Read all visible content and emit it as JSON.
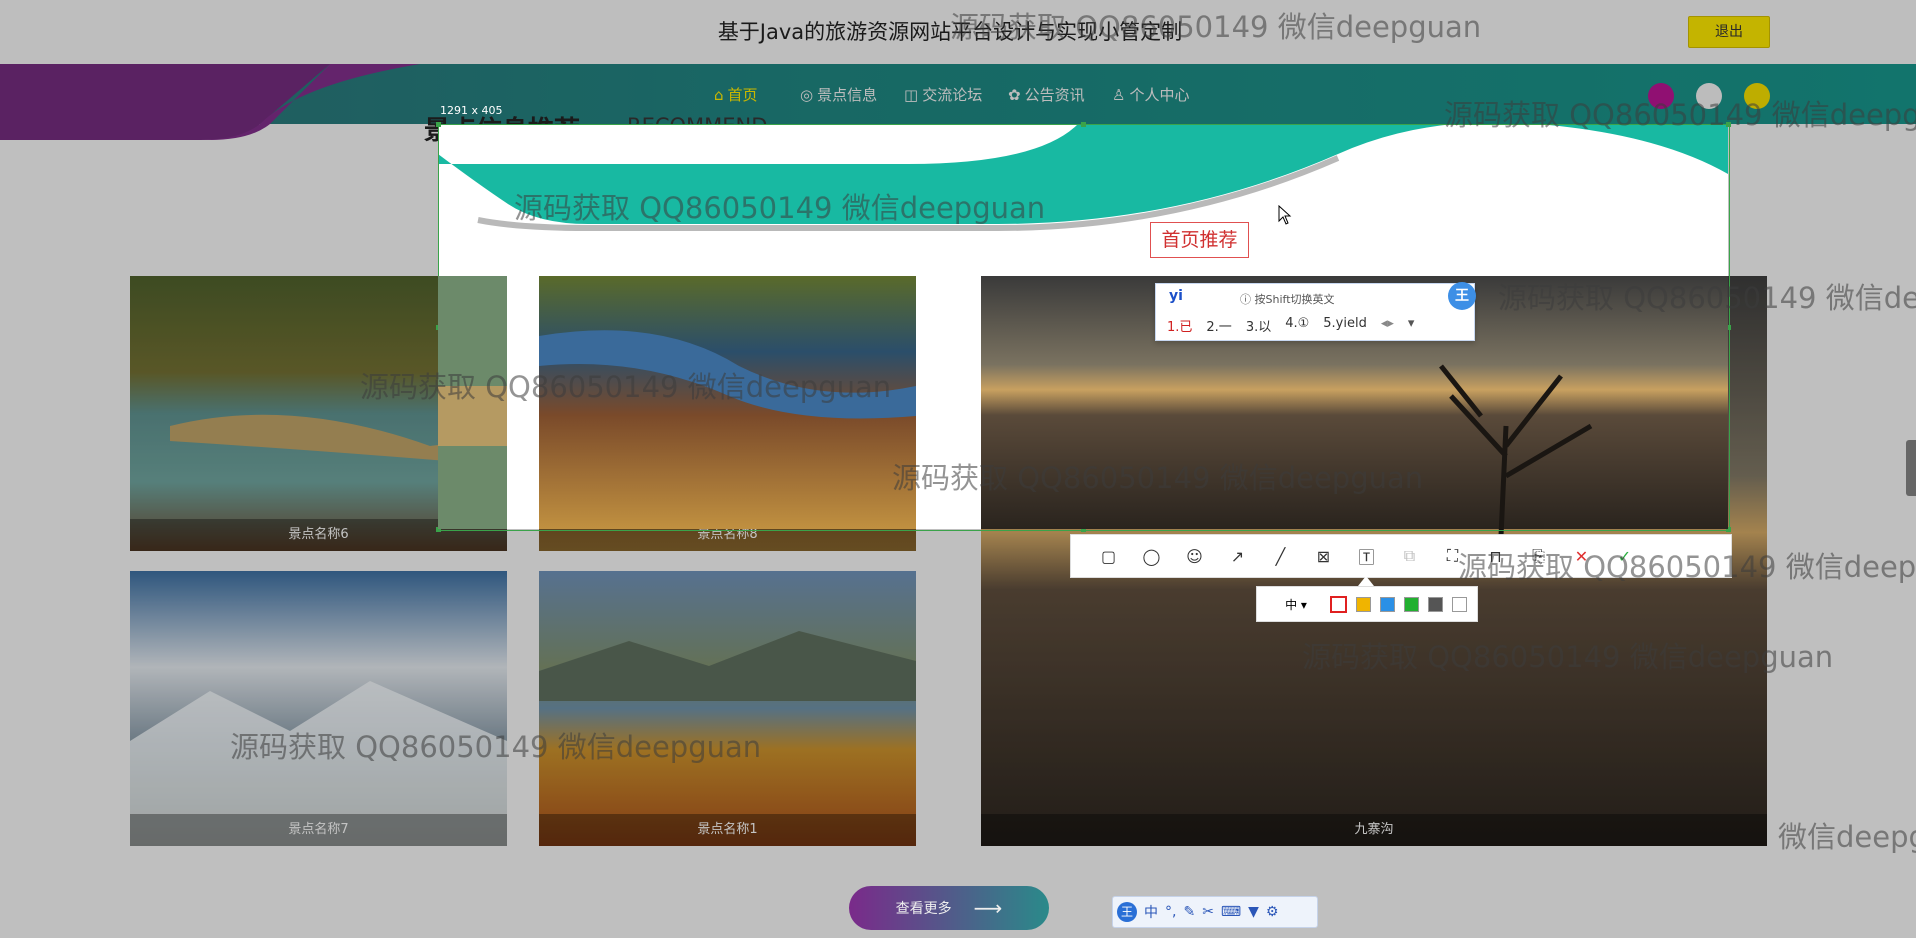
{
  "header": {
    "site_title": "基于Java的旅游资源网站平台设计与实现小管定制",
    "logout_label": "退出"
  },
  "nav": {
    "items": [
      {
        "label": "首页",
        "icon": "home-icon"
      },
      {
        "label": "景点信息",
        "icon": "globe-icon"
      },
      {
        "label": "交流论坛",
        "icon": "gift-icon"
      },
      {
        "label": "公告资讯",
        "icon": "gear-icon"
      },
      {
        "label": "个人中心",
        "icon": "user-icon"
      }
    ],
    "dots": [
      "#b0148c",
      "#e6e6e6",
      "#e8d400"
    ]
  },
  "section": {
    "title": "景点信息推荐",
    "subtitle": "RECOMMEND"
  },
  "spots": [
    {
      "name": "景点名称6"
    },
    {
      "name": "景点名称8"
    },
    {
      "name": "景点名称7"
    },
    {
      "name": "景点名称1"
    },
    {
      "name": "九寨沟"
    }
  ],
  "view_more_label": "查看更多",
  "screenshot_tool": {
    "size_label": "1291 x 405",
    "annotation_text": "首页推荐",
    "size_option": "中",
    "colors": [
      "#e02020",
      "#f0b400",
      "#2b90e6",
      "#22b030",
      "#555555",
      "#ffffff"
    ]
  },
  "ime": {
    "input": "yi",
    "tip": "按Shift切换英文",
    "logo": "王",
    "candidates": [
      "1.已",
      "2.一",
      "3.以",
      "4.①",
      "5.yield"
    ],
    "status_logo": "王",
    "status_mode": "中"
  },
  "watermark": "源码获取 QQ86050149 微信deepguan",
  "watermark_partial": "微信deepg"
}
